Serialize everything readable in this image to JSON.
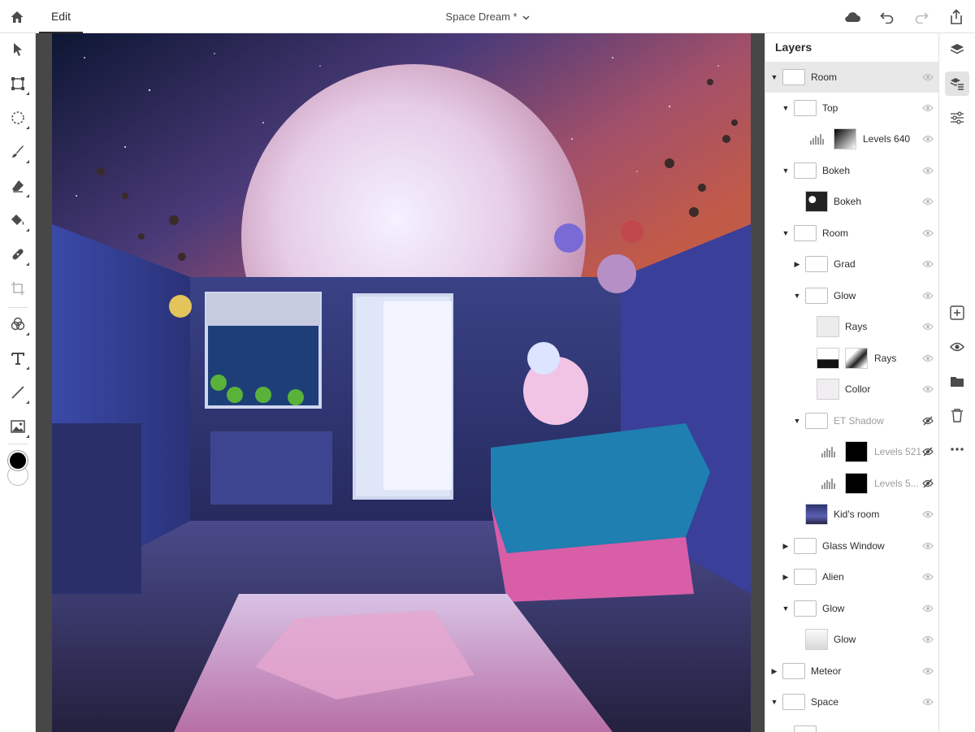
{
  "app": {
    "tab_edit": "Edit",
    "document_title": "Space Dream *"
  },
  "topbar_icons": [
    "home-icon",
    "cloud-icon",
    "undo-icon",
    "redo-icon",
    "share-icon"
  ],
  "left_tools": [
    "select-tool-icon",
    "transform-tool-icon",
    "lasso-select-icon",
    "brush-icon",
    "eraser-icon",
    "fill-bucket-icon",
    "healing-brush-icon",
    "crop-icon",
    "adjustments-icon",
    "type-tool-icon",
    "line-tool-icon",
    "place-image-icon"
  ],
  "colors": {
    "foreground": "#000000",
    "background": "#ffffff",
    "selected_row": "#e8e8e8"
  },
  "layers_panel": {
    "title": "Layers",
    "layers": [
      {
        "name": "Room",
        "kind": "group",
        "depth": 0,
        "expanded": true,
        "visible": true,
        "selected": true
      },
      {
        "name": "Top",
        "kind": "group",
        "depth": 1,
        "expanded": true,
        "visible": true
      },
      {
        "name": "Levels 640",
        "kind": "adjustment",
        "depth": 2,
        "visible": true
      },
      {
        "name": "Bokeh",
        "kind": "group",
        "depth": 1,
        "expanded": true,
        "visible": true
      },
      {
        "name": "Bokeh",
        "kind": "pixel",
        "depth": 2,
        "visible": true
      },
      {
        "name": "Room",
        "kind": "group",
        "depth": 1,
        "expanded": true,
        "visible": true
      },
      {
        "name": "Grad",
        "kind": "group",
        "depth": 2,
        "expanded": false,
        "visible": true
      },
      {
        "name": "Glow",
        "kind": "group",
        "depth": 2,
        "expanded": true,
        "visible": true
      },
      {
        "name": "Rays",
        "kind": "pixel",
        "depth": 3,
        "visible": true
      },
      {
        "name": "Rays",
        "kind": "masked",
        "depth": 3,
        "visible": true
      },
      {
        "name": "Collor",
        "kind": "pixel",
        "depth": 3,
        "visible": true
      },
      {
        "name": "ET Shadow",
        "kind": "group",
        "depth": 2,
        "expanded": true,
        "visible": false
      },
      {
        "name": "Levels 521",
        "kind": "adjustment",
        "depth": 3,
        "visible": false
      },
      {
        "name": "Levels 5...",
        "kind": "adjustment",
        "depth": 3,
        "visible": false
      },
      {
        "name": "Kid's room",
        "kind": "pixel",
        "depth": 2,
        "visible": true
      },
      {
        "name": "Glass Window",
        "kind": "group",
        "depth": 1,
        "expanded": false,
        "visible": true
      },
      {
        "name": "Alien",
        "kind": "group",
        "depth": 1,
        "expanded": false,
        "visible": true
      },
      {
        "name": "Glow",
        "kind": "group",
        "depth": 1,
        "expanded": true,
        "visible": true
      },
      {
        "name": "Glow",
        "kind": "pixel",
        "depth": 2,
        "visible": true
      },
      {
        "name": "Meteor",
        "kind": "group",
        "depth": 0,
        "expanded": false,
        "visible": true
      },
      {
        "name": "Space",
        "kind": "group",
        "depth": 0,
        "expanded": true,
        "visible": true
      }
    ]
  },
  "right_rail": [
    "layers-icon",
    "layer-properties-icon",
    "adjustments-sliders-icon",
    "add-layer-icon",
    "visibility-icon",
    "group-folder-icon",
    "delete-icon",
    "more-icon"
  ]
}
